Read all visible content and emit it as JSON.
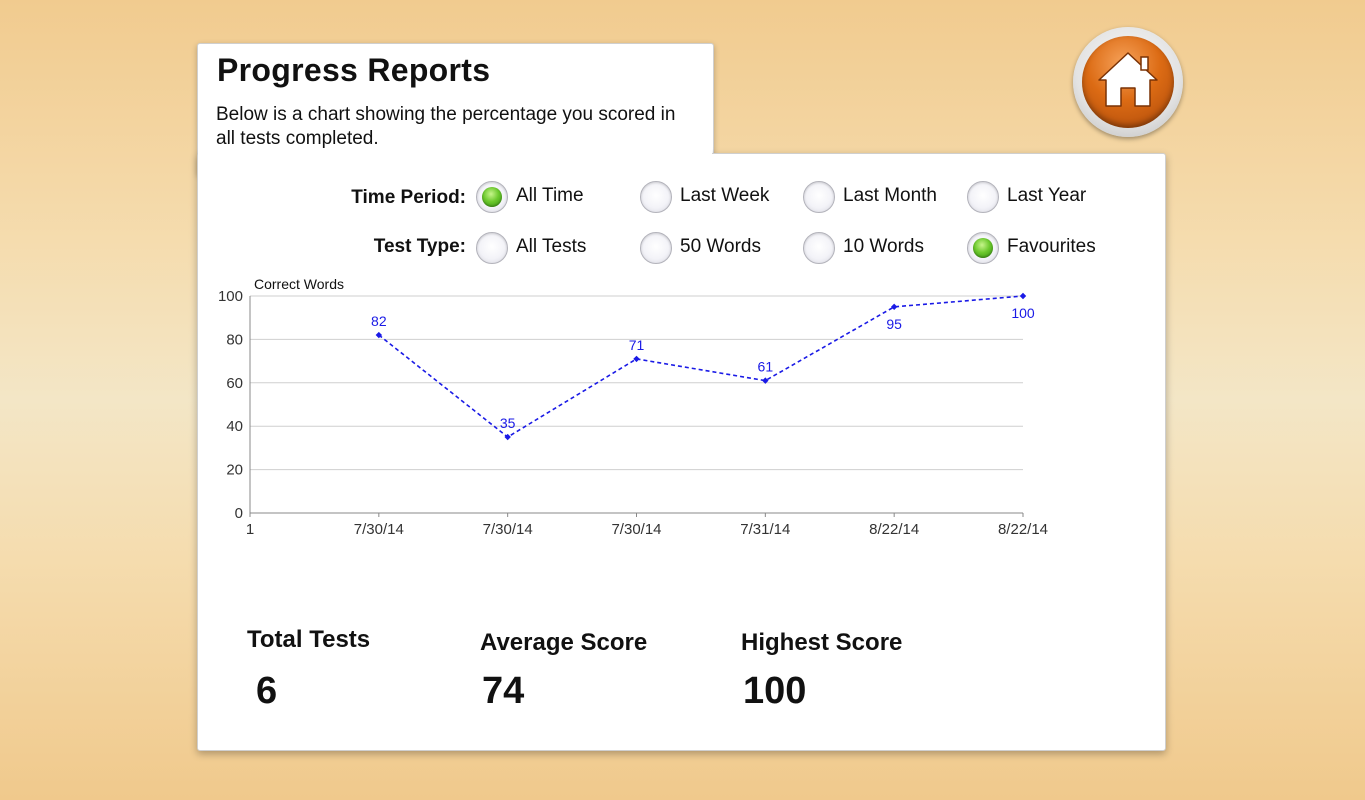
{
  "header": {
    "title": "Progress Reports",
    "subtitle": "Below is a chart showing the percentage you scored in all tests completed."
  },
  "home_button": {
    "icon": "home-icon",
    "accent": "#dc6b14"
  },
  "filters": {
    "time_period": {
      "label": "Time Period:",
      "options": [
        {
          "label": "All Time",
          "selected": true
        },
        {
          "label": "Last Week",
          "selected": false
        },
        {
          "label": "Last Month",
          "selected": false
        },
        {
          "label": "Last Year",
          "selected": false
        }
      ]
    },
    "test_type": {
      "label": "Test Type:",
      "options": [
        {
          "label": "All Tests",
          "selected": false
        },
        {
          "label": "50 Words",
          "selected": false
        },
        {
          "label": "10 Words",
          "selected": false
        },
        {
          "label": "Favourites",
          "selected": true
        }
      ]
    }
  },
  "chart_data": {
    "type": "line",
    "ylabel": "Correct Words",
    "x_tick_labels": [
      "1",
      "7/30/14",
      "7/30/14",
      "7/30/14",
      "7/31/14",
      "8/22/14",
      "8/22/14"
    ],
    "ylim": [
      0,
      100
    ],
    "y_ticks": [
      0,
      20,
      40,
      60,
      80,
      100
    ],
    "grid": true,
    "series_color": "#1a1ae6",
    "line_style": "dashed",
    "series": [
      {
        "x": [
          "7/30/14",
          "7/30/14",
          "7/30/14",
          "7/31/14",
          "8/22/14",
          "8/22/14"
        ],
        "values": [
          82,
          35,
          71,
          61,
          95,
          100
        ]
      }
    ]
  },
  "stats": {
    "total_tests": {
      "label": "Total Tests",
      "value": "6"
    },
    "average_score": {
      "label": "Average Score",
      "value": "74"
    },
    "highest_score": {
      "label": "Highest Score",
      "value": "100"
    }
  }
}
